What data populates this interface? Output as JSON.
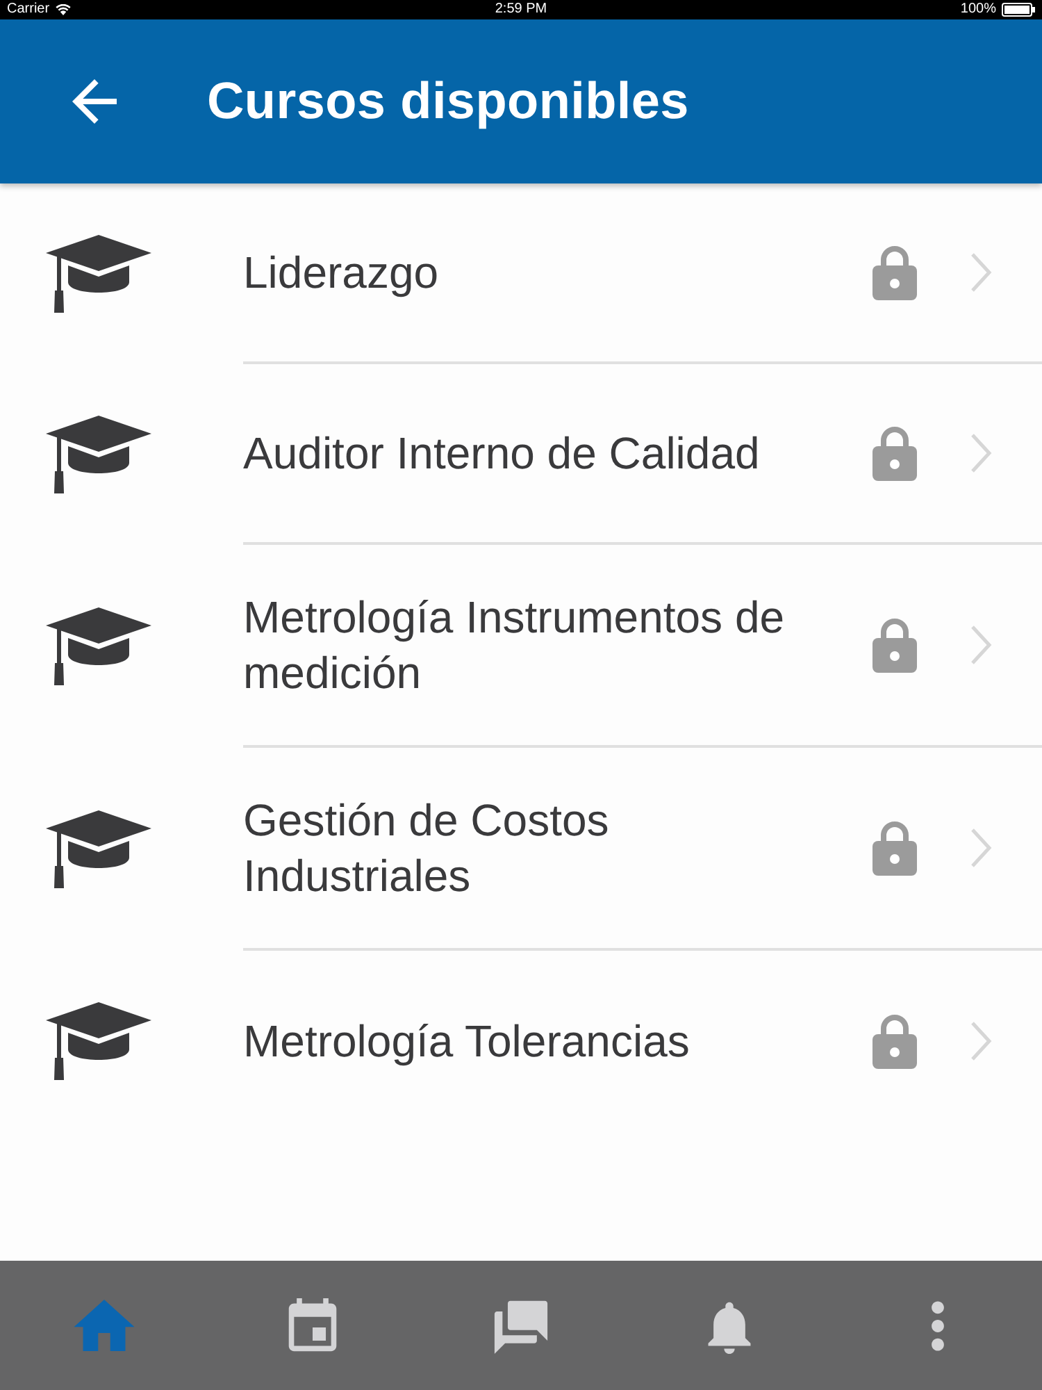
{
  "status_bar": {
    "carrier": "Carrier",
    "time": "2:59 PM",
    "battery": "100%"
  },
  "header": {
    "title": "Cursos disponibles"
  },
  "courses": [
    {
      "title": "Liderazgo",
      "locked": true
    },
    {
      "title": "Auditor Interno de Calidad",
      "locked": true
    },
    {
      "title": "Metrología Instrumentos de medición",
      "locked": true
    },
    {
      "title": "Gestión de Costos Industriales",
      "locked": true
    },
    {
      "title": "Metrología Tolerancias",
      "locked": true
    }
  ],
  "bottom_nav": [
    {
      "selected": true
    },
    {
      "selected": false
    },
    {
      "selected": false
    },
    {
      "selected": false
    },
    {
      "selected": false
    }
  ]
}
